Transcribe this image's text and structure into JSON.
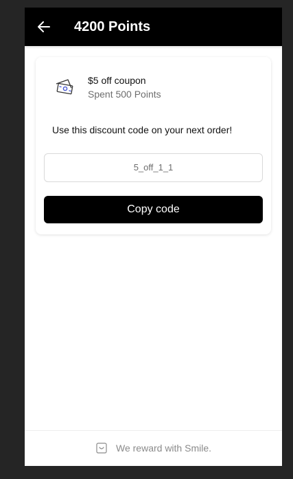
{
  "header": {
    "title": "4200 Points",
    "back_icon": "arrow-left-icon"
  },
  "coupon": {
    "icon": "money-coupon-icon",
    "name": "$5 off coupon",
    "spent": "Spent 500 Points",
    "instructions": "Use this discount code on your next order!",
    "code": "5_off_1_1",
    "copy_label": "Copy code"
  },
  "footer": {
    "icon": "smile-logo-icon",
    "text": "We reward with Smile."
  },
  "colors": {
    "header_bg": "#000000",
    "button_bg": "#000000",
    "icon_accent": "#4a5bd4"
  }
}
